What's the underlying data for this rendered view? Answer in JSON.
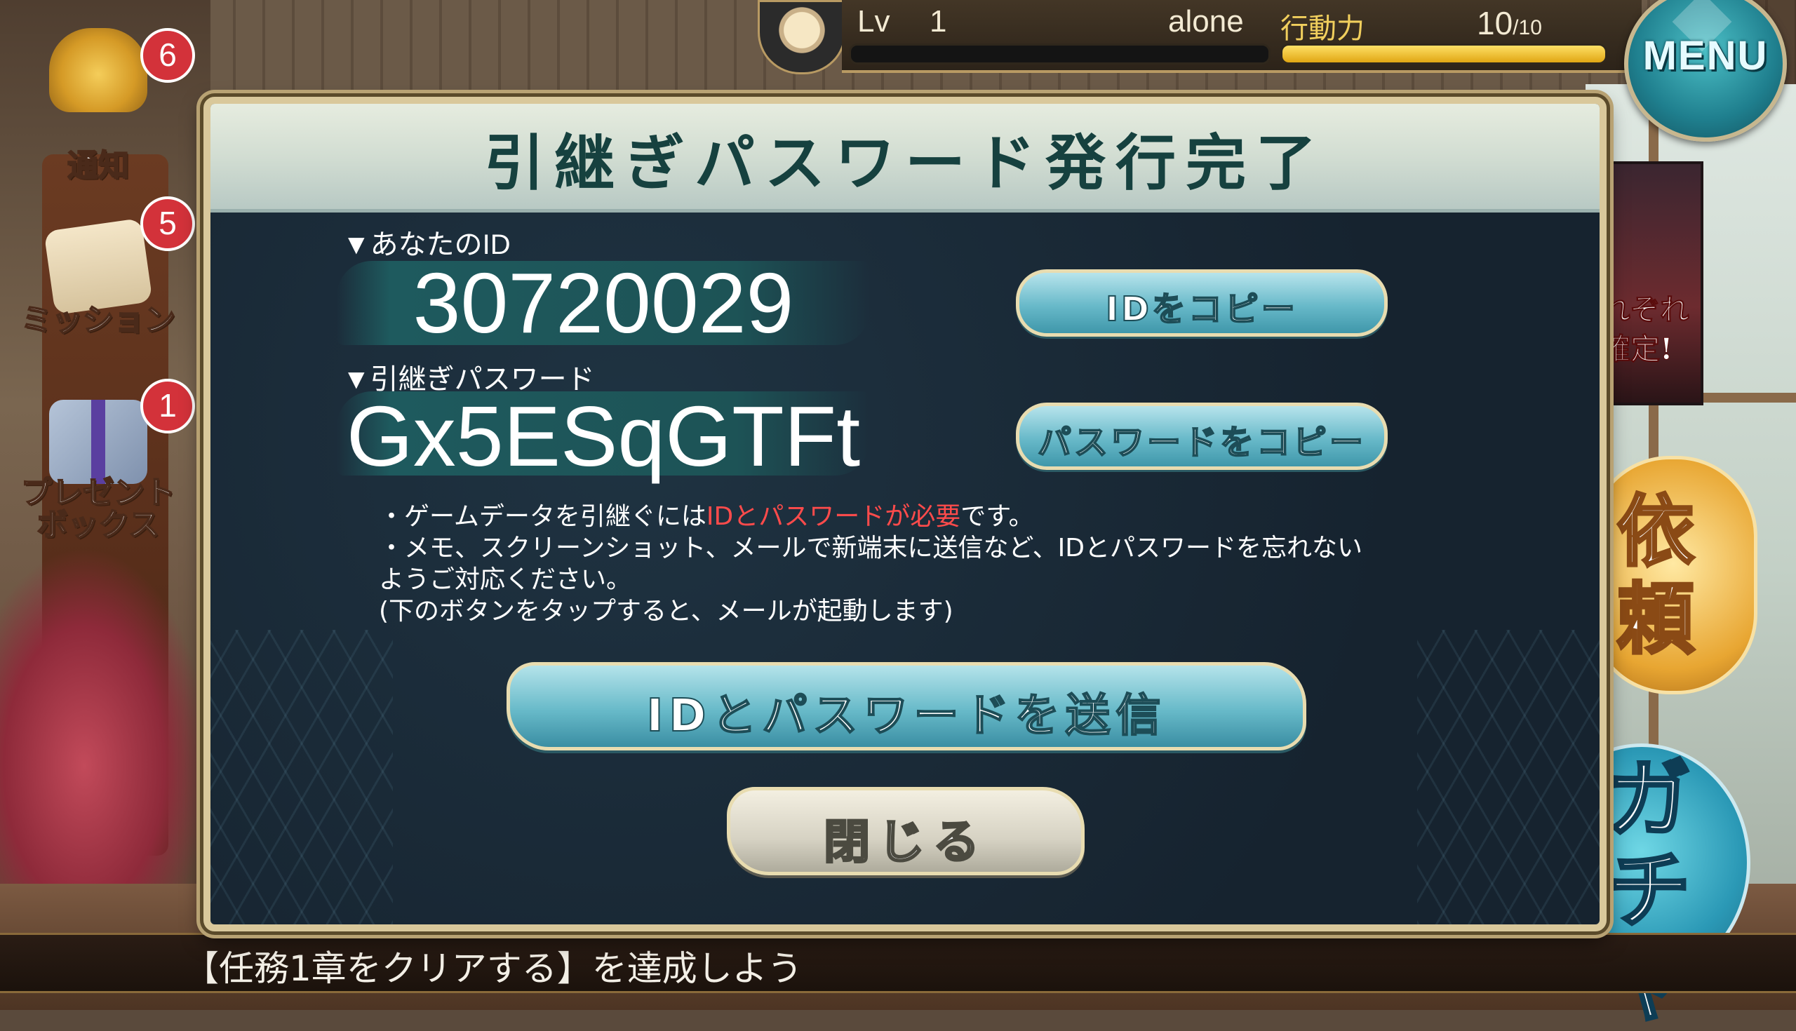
{
  "hud": {
    "lv_label": "Lv",
    "lv_value": "1",
    "player_name": "alone",
    "stamina_label": "行動力",
    "stamina_current": "10",
    "stamina_max": "/10",
    "stamina_fraction": 1.0,
    "menu_label": "MENU"
  },
  "sidebar": {
    "notice": {
      "label": "通知",
      "badge": "6",
      "icon": "bell-icon"
    },
    "mission": {
      "label": "ミッション",
      "badge": "5",
      "icon": "scroll-icon"
    },
    "present": {
      "label": "プレゼント\nボックス",
      "label_line1": "プレゼント",
      "label_line2": "ボックス",
      "badge": "1",
      "icon": "gift-icon"
    }
  },
  "right": {
    "banner_text_1": "れぞれ",
    "banner_text_2": "確定!",
    "quest_label_1": "依",
    "quest_label_2": "頼",
    "gacha_label_1": "ガ",
    "gacha_label_2": "チャ"
  },
  "dialog": {
    "title": "引継ぎパスワード発行完了",
    "id_label": "▼あなたのID",
    "id_value": "30720029",
    "copy_id_label": "IDをコピー",
    "password_label": "▼引継ぎパスワード",
    "password_value": "Gx5ESqGTFt",
    "copy_password_label": "パスワードをコピー",
    "notice_line1_prefix": "・ゲームデータを引継ぐには",
    "notice_line1_highlight": "IDとパスワードが必要",
    "notice_line1_suffix": "です。",
    "notice_line2": "・メモ、スクリーンショット、メールで新端末に送信など、IDとパスワードを忘れない",
    "notice_line3": "ようご対応ください。",
    "notice_line4": "(下のボタンをタップすると、メールが起動します)",
    "send_label": "IDとパスワードを送信",
    "close_label": "閉じる"
  },
  "ticker": {
    "text": "【任務1章をクリアする】を達成しよう"
  },
  "colors": {
    "accent_teal": "#68b9c9",
    "highlight_red": "#ff4b4b",
    "frame_gold": "#d9c89b"
  }
}
